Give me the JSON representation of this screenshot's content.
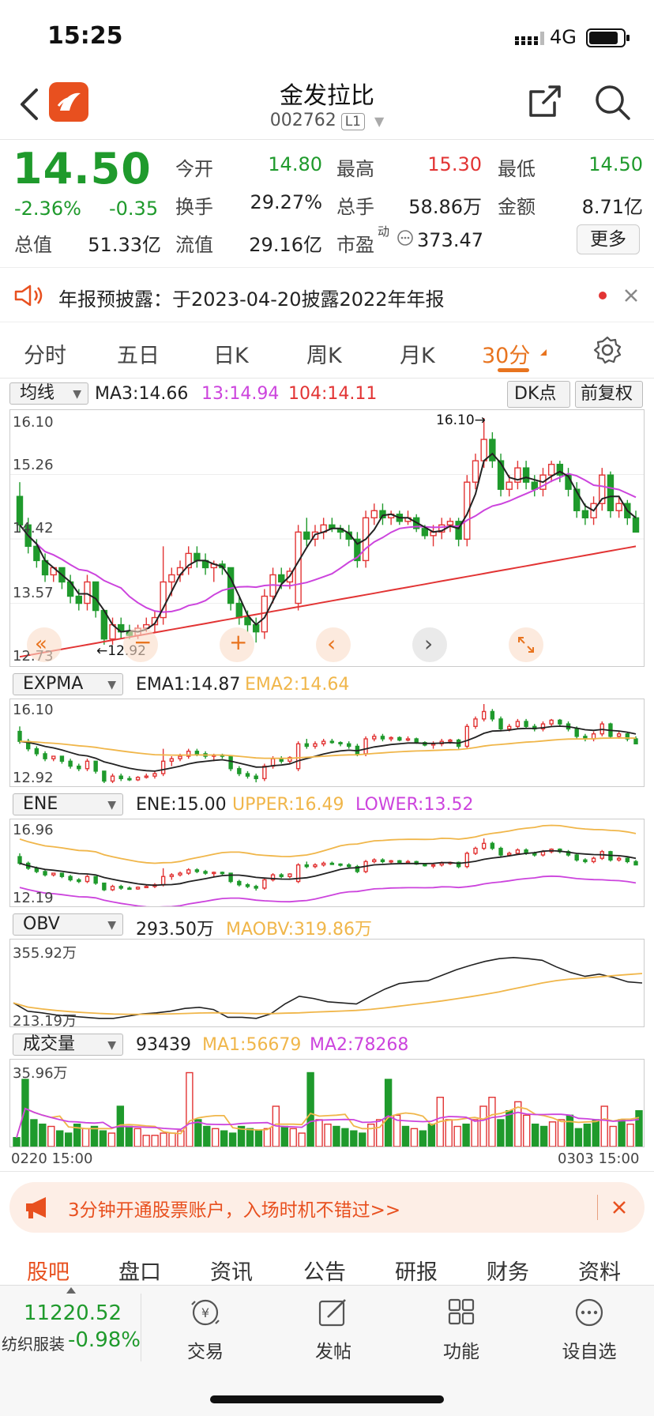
{
  "status": {
    "time": "15:25",
    "network": "4G"
  },
  "header": {
    "title": "金发拉比",
    "code": "002762",
    "level": "L1"
  },
  "quote": {
    "price": "14.50",
    "pct": "-2.36%",
    "chg": "-0.35",
    "open_label": "今开",
    "open": "14.80",
    "high_label": "最高",
    "high": "15.30",
    "low_label": "最低",
    "low": "14.50",
    "turnover_label": "换手",
    "turnover": "29.27%",
    "volume_label": "总手",
    "volume": "58.86万",
    "amount_label": "金额",
    "amount": "8.71亿",
    "mcap_label": "总值",
    "mcap": "51.33亿",
    "float_label": "流值",
    "float": "29.16亿",
    "pe_label": "市盈",
    "pe_sup": "动",
    "pe": "373.47",
    "more": "更多"
  },
  "notice": {
    "text": "年报预披露：于2023-04-20披露2022年年报"
  },
  "tabs": [
    {
      "label": "分时"
    },
    {
      "label": "五日"
    },
    {
      "label": "日K"
    },
    {
      "label": "周K"
    },
    {
      "label": "月K"
    },
    {
      "label": "30分"
    }
  ],
  "main_panel": {
    "selector": "均线",
    "ma3": "MA3:14.66",
    "ma13": "13:14.94",
    "ma104": "104:14.11",
    "dk": "DK点",
    "fq": "前复权",
    "y_labels": [
      "16.10",
      "15.26",
      "14.42",
      "13.57",
      "12.73"
    ],
    "high_mark": "16.10",
    "low_mark": "12.92"
  },
  "expma_panel": {
    "selector": "EXPMA",
    "ema1": "EMA1:14.87",
    "ema2": "EMA2:14.64",
    "y_top": "16.10",
    "y_bottom": "12.92"
  },
  "ene_panel": {
    "selector": "ENE",
    "ene": "ENE:15.00",
    "upper": "UPPER:16.49",
    "lower": "LOWER:13.52",
    "y_top": "16.96",
    "y_bottom": "12.19"
  },
  "obv_panel": {
    "selector": "OBV",
    "obv": "293.50万",
    "maobv": "MAOBV:319.86万",
    "y_top": "355.92万",
    "y_bottom": "213.19万"
  },
  "vol_panel": {
    "selector": "成交量",
    "vol": "93439",
    "ma1": "MA1:56679",
    "ma2": "MA2:78268",
    "y_top": "35.96万",
    "x_start": "0220 15:00",
    "x_end": "0303 15:00"
  },
  "chart_data": {
    "type": "candlestick",
    "ylim": [
      12.73,
      16.1
    ],
    "candles": [
      [
        15.0,
        15.2,
        14.5,
        14.6
      ],
      [
        14.6,
        14.7,
        14.2,
        14.3
      ],
      [
        14.3,
        14.4,
        14.0,
        14.1
      ],
      [
        14.1,
        14.2,
        13.8,
        13.9
      ],
      [
        13.9,
        14.0,
        13.8,
        14.0
      ],
      [
        14.0,
        14.0,
        13.7,
        13.8
      ],
      [
        13.8,
        13.9,
        13.5,
        13.6
      ],
      [
        13.6,
        13.7,
        13.4,
        13.5
      ],
      [
        13.5,
        13.9,
        13.4,
        13.8
      ],
      [
        13.8,
        13.8,
        13.3,
        13.4
      ],
      [
        13.4,
        13.4,
        12.92,
        13.0
      ],
      [
        13.0,
        13.3,
        12.92,
        13.2
      ],
      [
        13.2,
        13.3,
        13.0,
        13.1
      ],
      [
        13.1,
        13.2,
        13.0,
        13.05
      ],
      [
        13.05,
        13.2,
        13.0,
        13.15
      ],
      [
        13.15,
        13.3,
        13.1,
        13.2
      ],
      [
        13.2,
        13.4,
        13.1,
        13.3
      ],
      [
        13.3,
        14.3,
        13.2,
        13.8
      ],
      [
        13.8,
        14.0,
        13.6,
        13.9
      ],
      [
        13.9,
        14.1,
        13.8,
        14.0
      ],
      [
        14.0,
        14.3,
        13.9,
        14.2
      ],
      [
        14.2,
        14.3,
        14.0,
        14.1
      ],
      [
        14.1,
        14.2,
        13.9,
        14.0
      ],
      [
        14.0,
        14.1,
        13.8,
        14.05
      ],
      [
        14.05,
        14.1,
        13.9,
        14.0
      ],
      [
        14.0,
        14.0,
        13.4,
        13.5
      ],
      [
        13.5,
        13.6,
        13.2,
        13.3
      ],
      [
        13.3,
        13.4,
        13.1,
        13.2
      ],
      [
        13.2,
        13.3,
        12.95,
        13.1
      ],
      [
        13.1,
        13.7,
        13.0,
        13.6
      ],
      [
        13.6,
        14.0,
        13.5,
        13.9
      ],
      [
        13.9,
        14.0,
        13.7,
        13.8
      ],
      [
        13.8,
        14.0,
        13.7,
        13.95
      ],
      [
        13.5,
        14.6,
        13.4,
        14.5
      ],
      [
        14.5,
        14.7,
        14.3,
        14.4
      ],
      [
        14.4,
        14.6,
        14.3,
        14.5
      ],
      [
        14.5,
        14.7,
        14.4,
        14.6
      ],
      [
        14.6,
        14.7,
        14.5,
        14.55
      ],
      [
        14.55,
        14.6,
        14.4,
        14.5
      ],
      [
        14.5,
        14.6,
        14.3,
        14.4
      ],
      [
        14.4,
        14.5,
        14.0,
        14.1
      ],
      [
        14.1,
        14.8,
        14.0,
        14.7
      ],
      [
        14.7,
        14.9,
        14.6,
        14.8
      ],
      [
        14.8,
        14.9,
        14.6,
        14.7
      ],
      [
        14.7,
        14.8,
        14.6,
        14.75
      ],
      [
        14.75,
        14.8,
        14.6,
        14.65
      ],
      [
        14.65,
        14.8,
        14.6,
        14.7
      ],
      [
        14.7,
        14.75,
        14.5,
        14.55
      ],
      [
        14.55,
        14.6,
        14.4,
        14.45
      ],
      [
        14.45,
        14.6,
        14.3,
        14.5
      ],
      [
        14.5,
        14.7,
        14.4,
        14.6
      ],
      [
        14.6,
        14.7,
        14.5,
        14.65
      ],
      [
        14.65,
        14.7,
        14.3,
        14.4
      ],
      [
        14.4,
        15.3,
        14.3,
        15.2
      ],
      [
        15.2,
        15.6,
        15.1,
        15.5
      ],
      [
        15.5,
        16.1,
        15.4,
        15.8
      ],
      [
        15.8,
        15.9,
        15.4,
        15.5
      ],
      [
        15.5,
        15.6,
        15.0,
        15.1
      ],
      [
        15.1,
        15.3,
        15.0,
        15.2
      ],
      [
        15.2,
        15.5,
        15.1,
        15.4
      ],
      [
        15.4,
        15.5,
        15.1,
        15.2
      ],
      [
        15.2,
        15.3,
        15.0,
        15.1
      ],
      [
        15.1,
        15.4,
        15.0,
        15.3
      ],
      [
        15.3,
        15.5,
        15.2,
        15.45
      ],
      [
        15.45,
        15.5,
        15.2,
        15.3
      ],
      [
        15.3,
        15.4,
        15.0,
        15.1
      ],
      [
        15.1,
        15.2,
        14.7,
        14.8
      ],
      [
        14.8,
        14.9,
        14.6,
        14.7
      ],
      [
        14.7,
        15.0,
        14.6,
        14.9
      ],
      [
        14.9,
        15.4,
        14.8,
        15.3
      ],
      [
        15.3,
        15.35,
        14.7,
        14.8
      ],
      [
        14.8,
        15.0,
        14.7,
        14.9
      ],
      [
        14.9,
        14.95,
        14.6,
        14.7
      ],
      [
        14.7,
        14.8,
        14.5,
        14.5
      ]
    ],
    "volume": [
      4,
      30,
      12,
      10,
      9,
      7,
      6,
      10,
      8,
      9,
      7,
      6,
      18,
      9,
      8,
      5,
      5,
      6,
      6,
      7,
      33,
      12,
      9,
      8,
      7,
      6,
      9,
      8,
      7,
      8,
      18,
      9,
      8,
      6,
      33,
      12,
      10,
      9,
      8,
      7,
      6,
      10,
      12,
      30,
      14,
      9,
      8,
      7,
      10,
      22,
      12,
      9,
      10,
      12,
      18,
      22,
      12,
      16,
      20,
      14,
      10,
      9,
      11,
      12,
      14,
      8,
      10,
      12,
      18,
      9,
      12,
      10,
      16
    ],
    "obv": [
      250,
      235,
      232,
      228,
      226,
      224,
      222,
      222,
      226,
      230,
      232,
      235,
      240,
      242,
      238,
      224,
      224,
      222,
      230,
      248,
      262,
      258,
      252,
      250,
      248,
      262,
      275,
      285,
      288,
      290,
      300,
      310,
      318,
      325,
      330,
      332,
      330,
      327,
      315,
      305,
      298,
      302,
      296,
      288,
      286
    ],
    "obv_ylim": [
      213.19,
      355.92
    ]
  },
  "promo": {
    "text": "3分钟开通股票账户，入场时机不错过>>"
  },
  "subtabs": [
    "股吧",
    "盘口",
    "资讯",
    "公告",
    "研报",
    "财务",
    "资料"
  ],
  "bottom": {
    "index_value": "11220.52",
    "index_name": "纺织服装",
    "index_chg": "-0.98%",
    "items": [
      {
        "label": "交易"
      },
      {
        "label": "发帖"
      },
      {
        "label": "功能"
      },
      {
        "label": "设自选"
      }
    ]
  },
  "colors": {
    "up": "#e23434",
    "down": "#1f9a2c",
    "accent": "#e8741f",
    "ma3": "#222222",
    "ma13": "#cc44dd",
    "ma104": "#e23434",
    "yellow": "#f0b64a"
  }
}
